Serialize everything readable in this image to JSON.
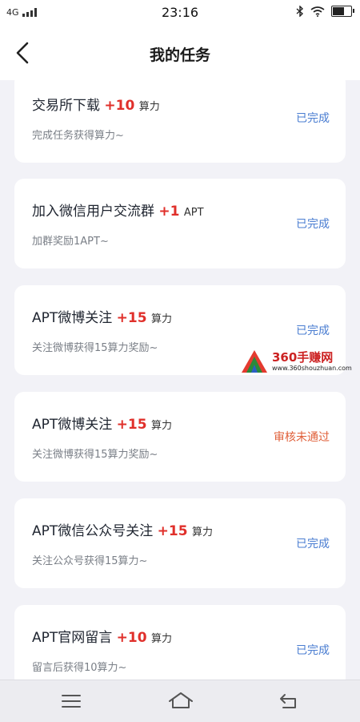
{
  "status_bar": {
    "network": "4G",
    "time": "23:16"
  },
  "header": {
    "title": "我的任务",
    "back_icon": "chevron-left-icon"
  },
  "tasks": [
    {
      "title": "交易所下载",
      "reward": "+10",
      "unit": "算力",
      "desc": "完成任务获得算力~",
      "status": "已完成",
      "status_color": "#4a7dd1"
    },
    {
      "title": "加入微信用户交流群",
      "reward": "+1",
      "unit": "APT",
      "desc": "加群奖励1APT~",
      "status": "已完成",
      "status_color": "#4a7dd1"
    },
    {
      "title": "APT微博关注",
      "reward": "+15",
      "unit": "算力",
      "desc": "关注微博获得15算力奖励~",
      "status": "已完成",
      "status_color": "#4a7dd1"
    },
    {
      "title": "APT微博关注",
      "reward": "+15",
      "unit": "算力",
      "desc": "关注微博获得15算力奖励~",
      "status": "审核未通过",
      "status_color": "#e0603a"
    },
    {
      "title": "APT微信公众号关注",
      "reward": "+15",
      "unit": "算力",
      "desc": "关注公众号获得15算力~",
      "status": "已完成",
      "status_color": "#4a7dd1"
    },
    {
      "title": "APT官网留言",
      "reward": "+10",
      "unit": "算力",
      "desc": "留言后获得10算力~",
      "status": "已完成",
      "status_color": "#4a7dd1"
    }
  ],
  "watermark": {
    "name": "360手赚网",
    "url": "www.360shouzhuan.com"
  },
  "nav_bar": {
    "menu_icon": "menu-icon",
    "home_icon": "home-icon",
    "back_icon": "return-icon"
  }
}
